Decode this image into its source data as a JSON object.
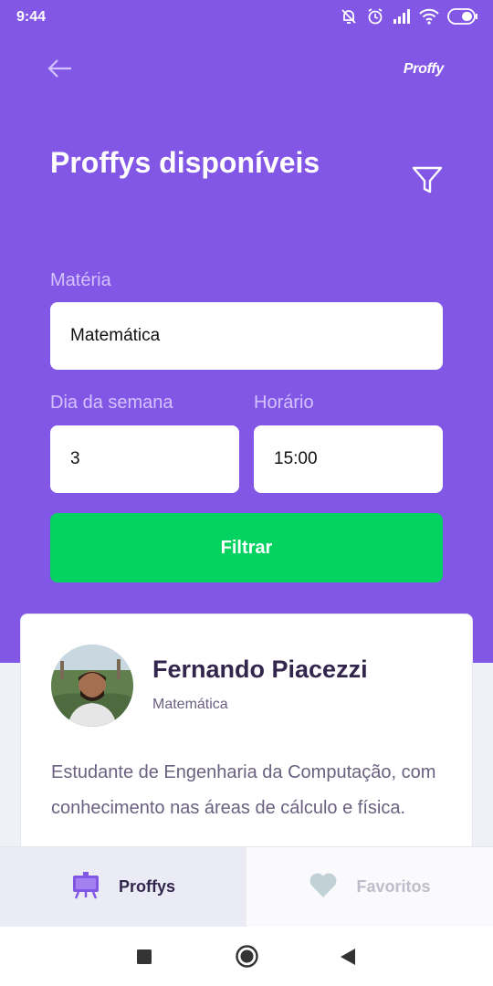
{
  "status_bar": {
    "time": "9:44",
    "icons": [
      "mute-alarm-icon",
      "alarm-icon",
      "signal-icon",
      "wifi-icon",
      "battery-icon"
    ]
  },
  "header": {
    "brand": "Proffy",
    "title": "Proffys disponíveis",
    "back_icon": "arrow-left-icon",
    "filter_icon": "filter-icon"
  },
  "filters": {
    "subject_label": "Matéria",
    "subject_value": "Matemática",
    "weekday_label": "Dia da semana",
    "weekday_value": "3",
    "time_label": "Horário",
    "time_value": "15:00",
    "submit_label": "Filtrar"
  },
  "teacher_card": {
    "name": "Fernando Piacezzi",
    "subject": "Matemática",
    "bio": "Estudante de Engenharia da Computação, com conhecimento nas áreas de cálculo e física."
  },
  "tabs": [
    {
      "label": "Proffys",
      "icon": "easel-icon",
      "active": true
    },
    {
      "label": "Favoritos",
      "icon": "heart-icon",
      "active": false
    }
  ],
  "nav_bar": {
    "icons": [
      "recents-square-icon",
      "home-circle-icon",
      "back-triangle-icon"
    ]
  },
  "colors": {
    "primary": "#8257e5",
    "secondary": "#04d361",
    "title_dark": "#32264d",
    "text_muted": "#6a6180"
  }
}
